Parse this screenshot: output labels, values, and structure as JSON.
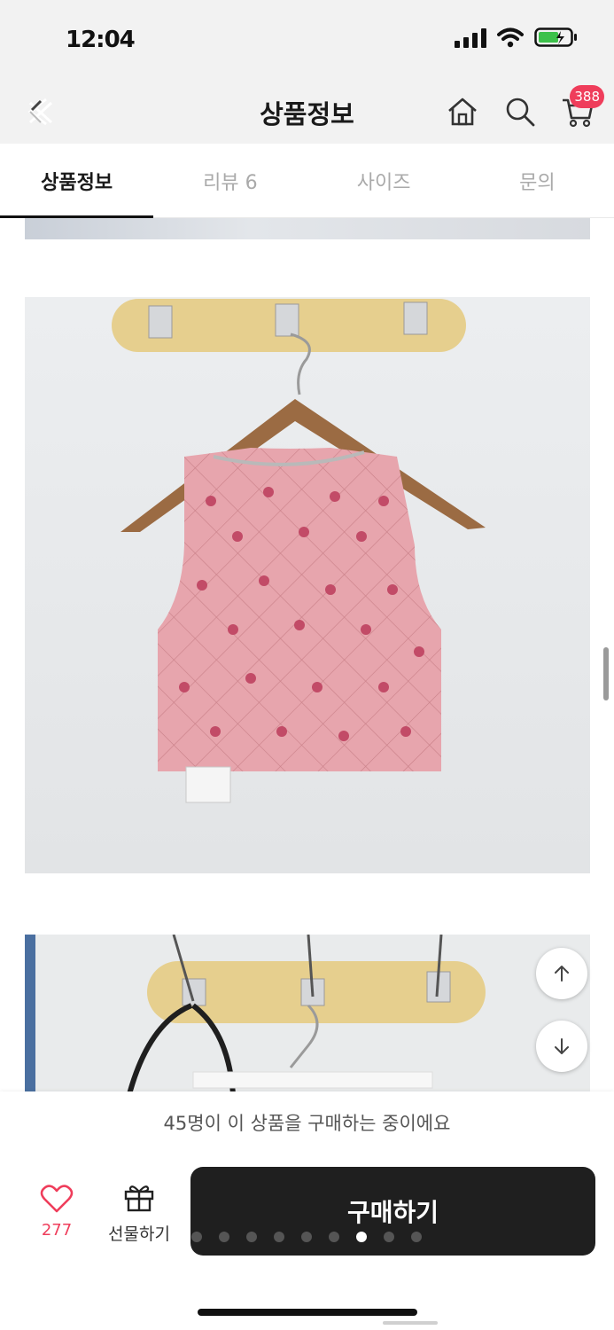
{
  "status_bar": {
    "time": "12:04",
    "icons": [
      "signal-icon",
      "wifi-icon",
      "battery-charging-icon"
    ]
  },
  "header": {
    "title": "상품정보",
    "cart_badge": "388",
    "icons": [
      "back-close-icon",
      "home-icon",
      "search-icon",
      "cart-icon"
    ]
  },
  "tabs": [
    {
      "label": "상품정보",
      "active": true
    },
    {
      "label": "리뷰 6",
      "active": false
    },
    {
      "label": "사이즈",
      "active": false
    },
    {
      "label": "문의",
      "active": false
    }
  ],
  "content": {
    "images": [
      {
        "description_icon": "product-image-top-strip"
      },
      {
        "description_icon": "product-image-pink-crop-top-on-hanger"
      },
      {
        "description_icon": "product-image-hanger-rack"
      }
    ]
  },
  "floating": {
    "scroll_up_icon": "arrow-up-icon",
    "scroll_down_icon": "arrow-down-icon"
  },
  "bottom_bar": {
    "buying_message": "45명이 이 상품을 구매하는 중이에요",
    "like_count": "277",
    "gift_label": "선물하기",
    "buy_label": "구매하기",
    "carousel": {
      "total": 9,
      "active_index": 6
    }
  },
  "colors": {
    "accent": "#ef3d5b",
    "buy_button": "#1f1f1f",
    "header_bg": "#f2f2f2"
  }
}
